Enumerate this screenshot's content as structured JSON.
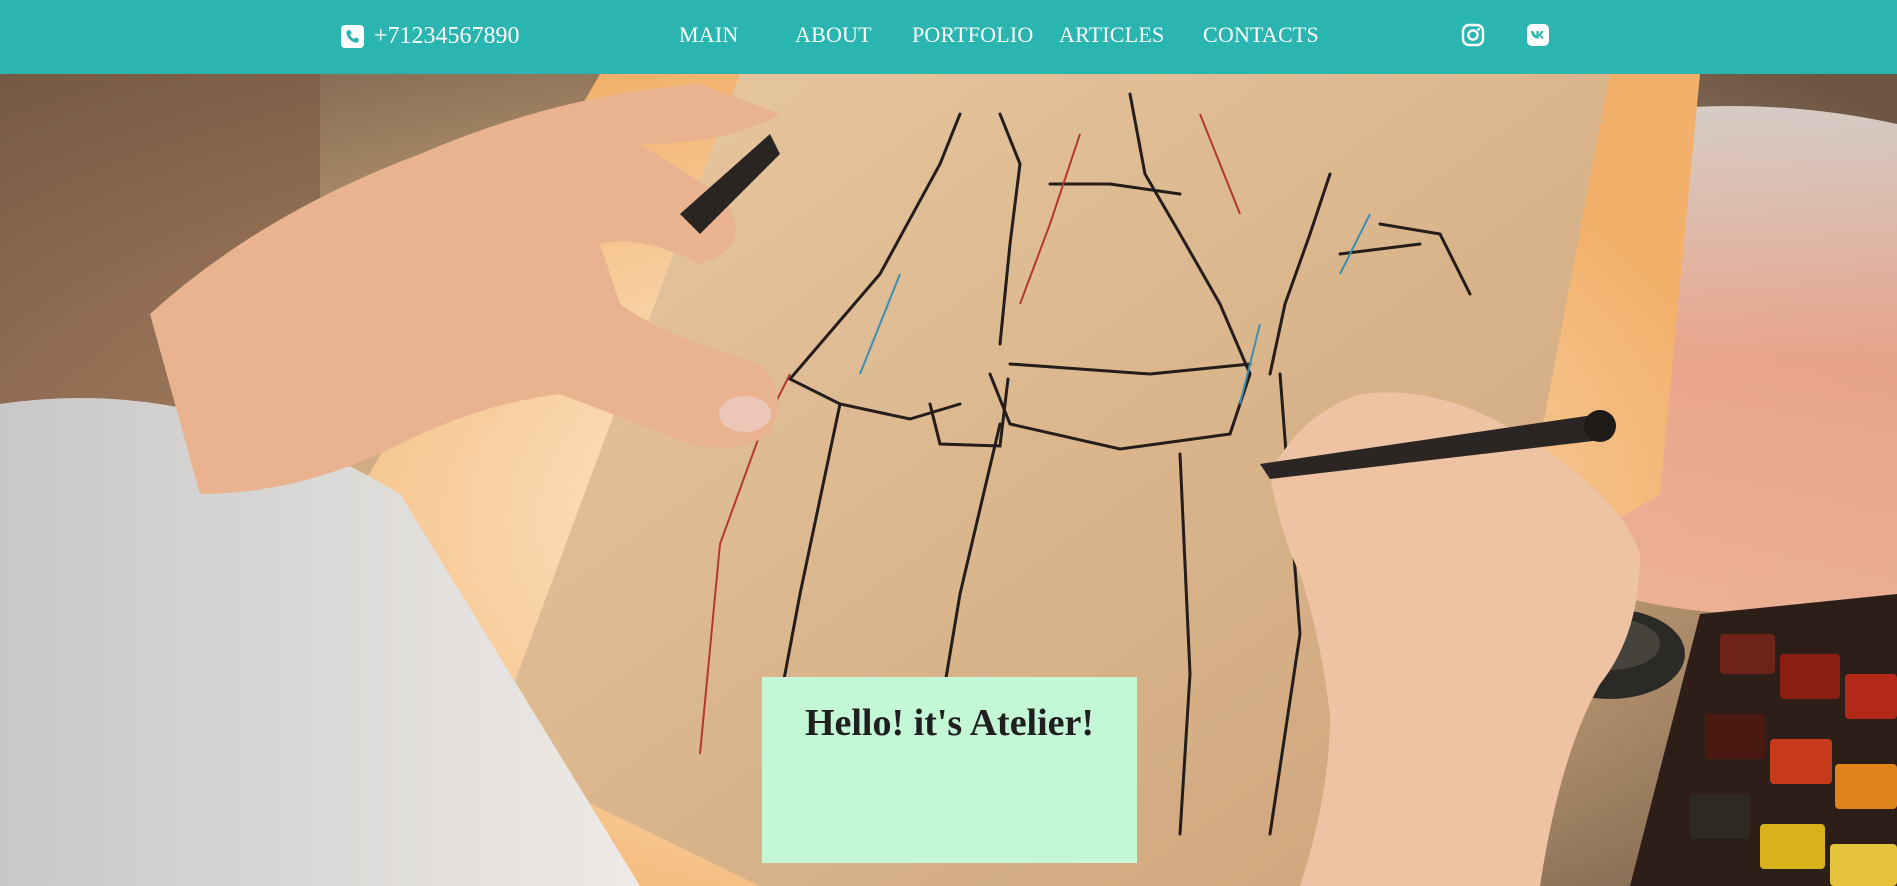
{
  "header": {
    "phone": "+71234567890",
    "phone_icon": "phone-icon",
    "nav": [
      {
        "label": "MAIN"
      },
      {
        "label": "ABOUT"
      },
      {
        "label": "PORTFOLIO"
      },
      {
        "label": "ARTICLES"
      },
      {
        "label": "CONTACTS"
      }
    ],
    "social": [
      "instagram-icon",
      "vk-icon"
    ]
  },
  "hero": {
    "image": "hands sketching dresses on a lightbox",
    "title": "Hello! it's Atelier!"
  },
  "colors": {
    "header_bg": "#2ab5b0",
    "hello_box_bg": "#c3f7d6",
    "text_light": "#ffffff",
    "text_dark": "#1f1f1f"
  }
}
